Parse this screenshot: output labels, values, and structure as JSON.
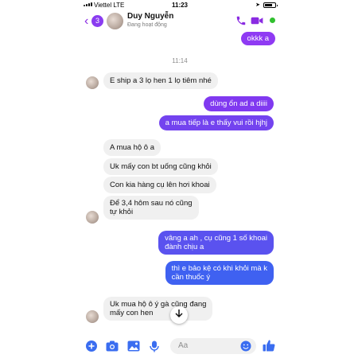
{
  "status_bar": {
    "carrier": "Viettel  LTE",
    "time": "11:23"
  },
  "header": {
    "badge_count": "3",
    "contact_name": "Duy Nguyễn",
    "presence": "Đang hoạt động"
  },
  "colors": {
    "accent": "#8a2be2",
    "online": "#31c02f",
    "incoming_bubble": "#f0f0f0"
  },
  "timestamp": "11:14",
  "messages": [
    {
      "side": "out",
      "text": "okkk a"
    },
    {
      "side": "in",
      "text": "E ship a 3 lọ hen 1 lọ tiêm nhé"
    },
    {
      "side": "out",
      "text": "dùng ổn ad a diiii"
    },
    {
      "side": "out",
      "text": "a mua tiếp là e thấy vui rồi hjhj"
    },
    {
      "side": "in",
      "text": "A mua hộ ô a"
    },
    {
      "side": "in",
      "text": "Uk mấy con bt uống cũng khỏi"
    },
    {
      "side": "in",
      "text": "Con kia hàng cụ lên hơi khoai"
    },
    {
      "side": "in",
      "text": "Để 3,4 hôm sau nó cũng",
      "text2": "tự khỏi"
    },
    {
      "side": "out",
      "text": "vâng a ah , cụ cũng 1 số khoai",
      "text2": "đành chịu a"
    },
    {
      "side": "out",
      "text": "thì e bảo kệ có khi khỏi mà k",
      "text2": "cần thuốc ý"
    },
    {
      "side": "in",
      "text": "Uk mua hộ ô ý gà cũng đang",
      "text2": "mấy con hen"
    }
  ],
  "composer": {
    "placeholder": "Aa"
  },
  "icons": [
    "back-chevron-icon",
    "phone-icon",
    "video-camera-icon",
    "plus-icon",
    "camera-icon",
    "image-icon",
    "microphone-icon",
    "emoji-icon",
    "like-thumb-icon",
    "scroll-down-arrow-icon"
  ]
}
